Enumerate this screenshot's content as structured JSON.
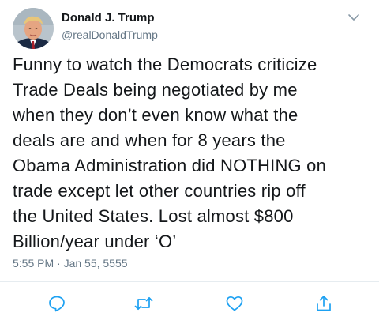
{
  "author": {
    "display_name": "Donald J. Trump",
    "handle": "@realDonaldTrump",
    "avatar_icon": "profile-photo"
  },
  "tweet": {
    "lines": [
      "Funny to watch the Democrats criticize",
      "Trade Deals being negotiated by me",
      "when they don’t even know what the",
      "deals are and when for 8 years the",
      "Obama Administration did NOTHING on",
      "trade except let other countries rip off",
      "the United States. Lost almost $800",
      "Billion/year under ‘O’"
    ],
    "timestamp": "5:55 PM · Jan 55, 5555"
  },
  "actions": [
    {
      "name": "reply",
      "icon": "reply-icon"
    },
    {
      "name": "retweet",
      "icon": "retweet-icon"
    },
    {
      "name": "like",
      "icon": "heart-icon"
    },
    {
      "name": "share",
      "icon": "share-icon"
    }
  ],
  "colors": {
    "text": "#14171a",
    "secondary": "#657786",
    "icon": "#1da1f2",
    "divider": "#e6ecf0"
  }
}
